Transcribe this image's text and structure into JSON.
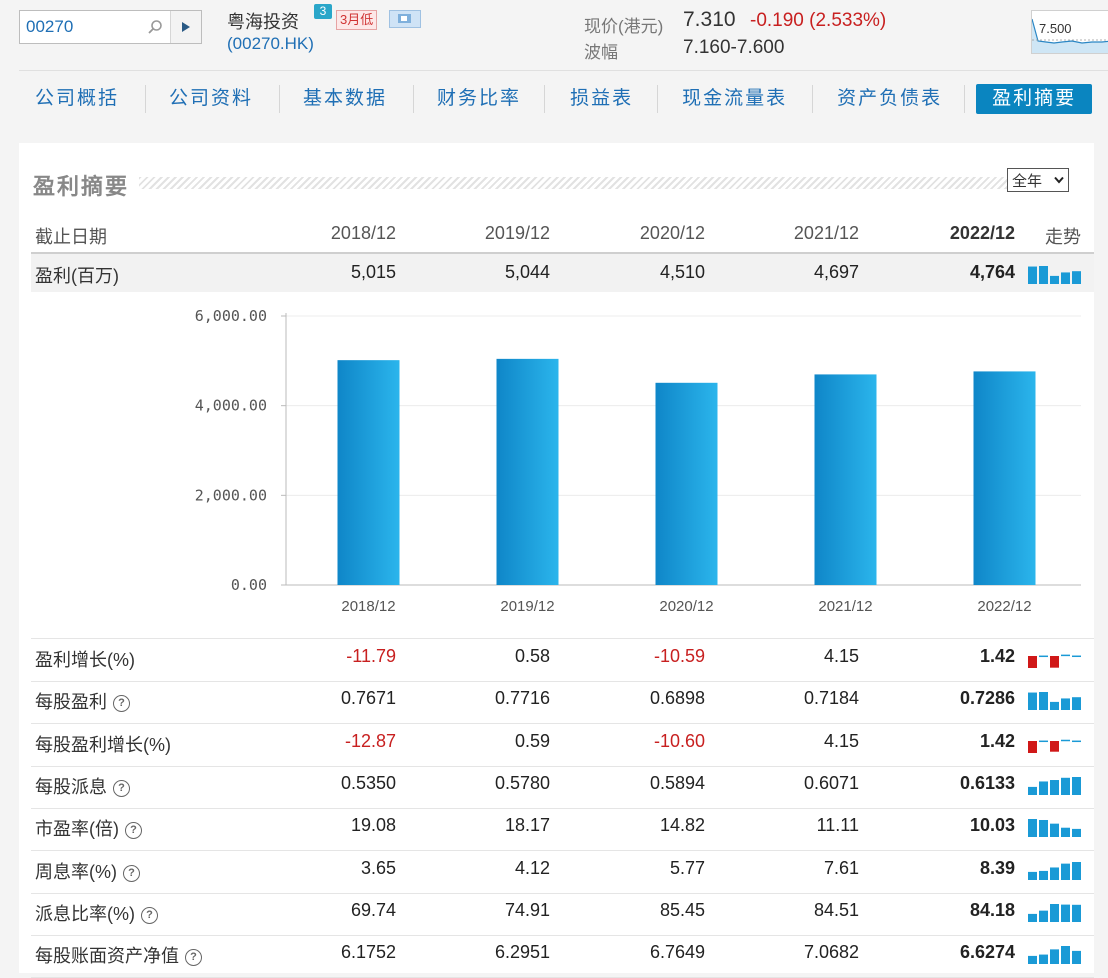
{
  "search": {
    "value": "00270"
  },
  "stock": {
    "name": "粤海投资",
    "badge": "3",
    "tag": "3月低",
    "code": "(00270.HK)"
  },
  "quote": {
    "price_label": "现价(港元)",
    "price": "7.310",
    "change": "-0.190 (2.533%)",
    "range_label": "波幅",
    "range": "7.160-7.600",
    "mini_chart_label": "7.500"
  },
  "tabs": [
    {
      "label": "公司概括"
    },
    {
      "label": "公司资料"
    },
    {
      "label": "基本数据"
    },
    {
      "label": "财务比率"
    },
    {
      "label": "损益表"
    },
    {
      "label": "现金流量表"
    },
    {
      "label": "资产负债表"
    },
    {
      "label": "盈利摘要",
      "active": true
    }
  ],
  "section": {
    "title": "盈利摘要",
    "period": "全年"
  },
  "table": {
    "header": {
      "label": "截止日期",
      "years": [
        "2018/12",
        "2019/12",
        "2020/12",
        "2021/12",
        "2022/12"
      ],
      "trend": "走势"
    },
    "rows": [
      {
        "label": "盈利(百万)",
        "help": false,
        "values": [
          "5,015",
          "5,044",
          "4,510",
          "4,697",
          "4,764"
        ],
        "trend": [
          5015,
          5044,
          4510,
          4697,
          4764
        ]
      },
      {
        "label": "盈利增长(%)",
        "help": false,
        "values": [
          "-11.79",
          "0.58",
          "-10.59",
          "4.15",
          "1.42"
        ],
        "trend": [
          -11.79,
          0.58,
          -10.59,
          4.15,
          1.42
        ]
      },
      {
        "label": "每股盈利",
        "help": true,
        "values": [
          "0.7671",
          "0.7716",
          "0.6898",
          "0.7184",
          "0.7286"
        ],
        "trend": [
          0.7671,
          0.7716,
          0.6898,
          0.7184,
          0.7286
        ]
      },
      {
        "label": "每股盈利增长(%)",
        "help": false,
        "values": [
          "-12.87",
          "0.59",
          "-10.60",
          "4.15",
          "1.42"
        ],
        "trend": [
          -12.87,
          0.59,
          -10.6,
          4.15,
          1.42
        ]
      },
      {
        "label": "每股派息",
        "help": true,
        "values": [
          "0.5350",
          "0.5780",
          "0.5894",
          "0.6071",
          "0.6133"
        ],
        "trend": [
          0.535,
          0.578,
          0.5894,
          0.6071,
          0.6133
        ]
      },
      {
        "label": "市盈率(倍)",
        "help": true,
        "values": [
          "19.08",
          "18.17",
          "14.82",
          "11.11",
          "10.03"
        ],
        "trend": [
          19.08,
          18.17,
          14.82,
          11.11,
          10.03
        ]
      },
      {
        "label": "周息率(%)",
        "help": true,
        "values": [
          "3.65",
          "4.12",
          "5.77",
          "7.61",
          "8.39"
        ],
        "trend": [
          3.65,
          4.12,
          5.77,
          7.61,
          8.39
        ]
      },
      {
        "label": "派息比率(%)",
        "help": true,
        "values": [
          "69.74",
          "74.91",
          "85.45",
          "84.51",
          "84.18"
        ],
        "trend": [
          69.74,
          74.91,
          85.45,
          84.51,
          84.18
        ]
      },
      {
        "label": "每股账面资产净值",
        "help": true,
        "values": [
          "6.1752",
          "6.2951",
          "6.7649",
          "7.0682",
          "6.6274"
        ],
        "trend": [
          6.1752,
          6.2951,
          6.7649,
          7.0682,
          6.6274
        ]
      }
    ]
  },
  "chart_data": {
    "type": "bar",
    "categories": [
      "2018/12",
      "2019/12",
      "2020/12",
      "2021/12",
      "2022/12"
    ],
    "values": [
      5015,
      5044,
      4510,
      4697,
      4764
    ],
    "title": "",
    "xlabel": "",
    "ylabel": "",
    "ylim": [
      0,
      6000
    ],
    "yticks": [
      "0.00",
      "2,000.00",
      "4,000.00",
      "6,000.00"
    ],
    "ytick_values": [
      0,
      2000,
      4000,
      6000
    ],
    "grid": true,
    "color": "#1a9ad6"
  },
  "colors": {
    "accent": "#0a85c0",
    "negative": "#c82020",
    "link": "#1f6fb5",
    "bar": "#1a9ad6"
  }
}
